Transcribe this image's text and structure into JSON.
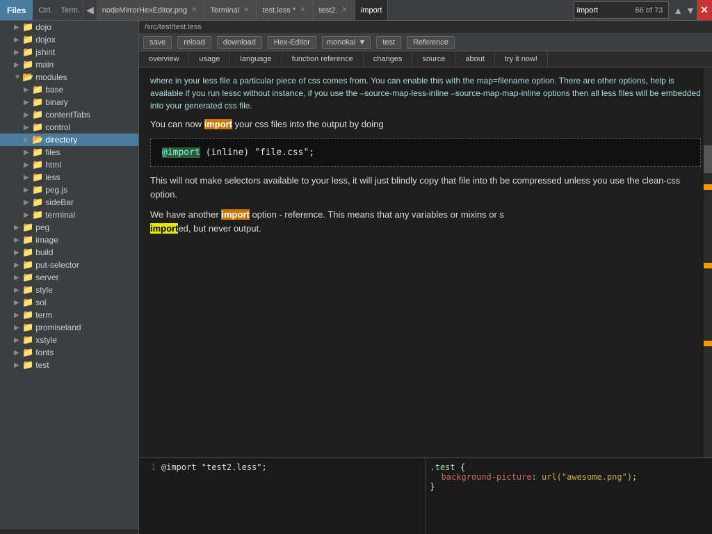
{
  "topbar": {
    "files_label": "Files",
    "ctrl_label": "Ctrl.",
    "term_label": "Term.",
    "tabs": [
      {
        "label": "nodeMirrorHexEditor.png",
        "active": false
      },
      {
        "label": "Terminal",
        "active": false
      },
      {
        "label": "test.less *",
        "active": false
      },
      {
        "label": "test2.",
        "active": false
      },
      {
        "label": "import",
        "active": true
      }
    ],
    "search_value": "import",
    "search_count": "66 of 73"
  },
  "path": "/src/test/test.less",
  "toolbar": {
    "save": "save",
    "reload": "reload",
    "download": "download",
    "hex_editor": "Hex-Editor",
    "theme": "monokai",
    "test": "test",
    "reference": "Reference"
  },
  "nav_tabs": [
    "overview",
    "usage",
    "language",
    "function reference",
    "changes",
    "source",
    "about",
    "try it now!"
  ],
  "doc_content": {
    "para1": "where in your less file a particular piece of css comes from. You can enable this with the map=filename option. There are other options, help is available if you run lessc without instance, if you use the –source-map-less-inline –source-map-map-inline options then all less files will be embedded into your generated css file.",
    "para2_prefix": "You can now ",
    "para2_highlight": "import",
    "para2_suffix": " your css files into the output by doing",
    "code1_kw": "@import",
    "code1_rest": " (inline) \"file.css\";",
    "para3": "This will not make selectors available to your less, it will just blindly copy that file into th be compressed unless you use the clean-css option.",
    "para4_prefix": "We have another ",
    "para4_highlight1": "import",
    "para4_suffix1": " option - reference. This means that any variables or mixins or s",
    "para4_highlight2": "import",
    "para4_suffix2": "ed, but never output."
  },
  "code_pane_left": {
    "line1_num": "1",
    "line1_code": "@import \"test2.less\";"
  },
  "code_pane_right": {
    "line1": ".test {",
    "line2_prop": "background-picture",
    "line2_val": " url(\"awesome.png\");",
    "line3": "}"
  },
  "sidebar": {
    "items": [
      {
        "label": "dojo",
        "indent": 1,
        "type": "folder",
        "expanded": false
      },
      {
        "label": "dojox",
        "indent": 1,
        "type": "folder",
        "expanded": false
      },
      {
        "label": "jshint",
        "indent": 1,
        "type": "folder",
        "expanded": false
      },
      {
        "label": "main",
        "indent": 1,
        "type": "folder",
        "expanded": false
      },
      {
        "label": "modules",
        "indent": 1,
        "type": "folder",
        "expanded": true
      },
      {
        "label": "base",
        "indent": 2,
        "type": "folder",
        "expanded": false
      },
      {
        "label": "binary",
        "indent": 2,
        "type": "folder",
        "expanded": false
      },
      {
        "label": "contentTabs",
        "indent": 2,
        "type": "folder",
        "expanded": false
      },
      {
        "label": "control",
        "indent": 2,
        "type": "folder",
        "expanded": false
      },
      {
        "label": "directory",
        "indent": 2,
        "type": "folder",
        "expanded": false,
        "selected": true
      },
      {
        "label": "files",
        "indent": 2,
        "type": "folder",
        "expanded": false
      },
      {
        "label": "html",
        "indent": 2,
        "type": "folder",
        "expanded": false
      },
      {
        "label": "less",
        "indent": 2,
        "type": "folder",
        "expanded": false
      },
      {
        "label": "peg.js",
        "indent": 2,
        "type": "folder",
        "expanded": false
      },
      {
        "label": "sideBar",
        "indent": 2,
        "type": "folder",
        "expanded": false
      },
      {
        "label": "terminal",
        "indent": 2,
        "type": "folder",
        "expanded": false
      },
      {
        "label": "peg",
        "indent": 1,
        "type": "folder",
        "expanded": false
      },
      {
        "label": "image",
        "indent": 1,
        "type": "folder",
        "expanded": false
      },
      {
        "label": "build",
        "indent": 1,
        "type": "folder",
        "expanded": false
      },
      {
        "label": "put-selector",
        "indent": 1,
        "type": "folder",
        "expanded": false
      },
      {
        "label": "server",
        "indent": 1,
        "type": "folder",
        "expanded": false
      },
      {
        "label": "style",
        "indent": 1,
        "type": "folder",
        "expanded": false
      },
      {
        "label": "sol",
        "indent": 1,
        "type": "folder",
        "expanded": false
      },
      {
        "label": "term",
        "indent": 1,
        "type": "folder",
        "expanded": false
      },
      {
        "label": "promiseland",
        "indent": 1,
        "type": "folder",
        "expanded": false
      },
      {
        "label": "xstyle",
        "indent": 1,
        "type": "folder",
        "expanded": false
      },
      {
        "label": "fonts",
        "indent": 1,
        "type": "folder",
        "expanded": false
      },
      {
        "label": "test",
        "indent": 1,
        "type": "folder",
        "expanded": false
      }
    ]
  }
}
